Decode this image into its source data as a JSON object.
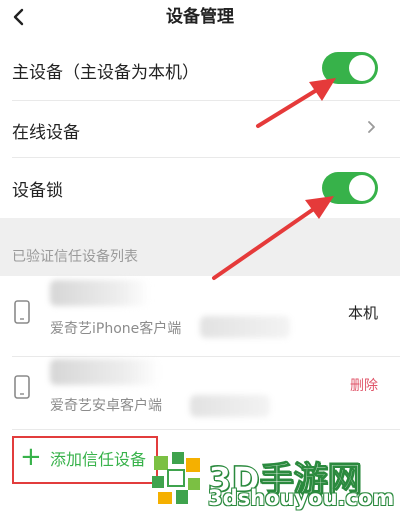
{
  "header": {
    "title": "设备管理",
    "back_icon": "chevron-left-icon"
  },
  "settings": {
    "primary_device": {
      "label": "主设备（主设备为本机）",
      "enabled": true
    },
    "online_devices": {
      "label": "在线设备",
      "icon": "chevron-right-icon"
    },
    "device_lock": {
      "label": "设备锁",
      "enabled": true
    }
  },
  "trusted": {
    "section_title": "已验证信任设备列表",
    "devices": [
      {
        "desc": "爱奇艺iPhone客户端",
        "status": "本机",
        "icon": "phone-icon"
      },
      {
        "desc": "爱奇艺安卓客户端",
        "action": "删除",
        "icon": "phone-icon"
      }
    ],
    "add_label": "添加信任设备"
  },
  "watermark": {
    "brand": "3D手游网",
    "domain": "3dshouyou.com"
  },
  "colors": {
    "toggle_on": "#37b24a",
    "accent_green": "#37b24a",
    "delete_red": "#e0566a",
    "highlight_red": "#e23c3c",
    "arrow_red": "#e53a3a"
  }
}
